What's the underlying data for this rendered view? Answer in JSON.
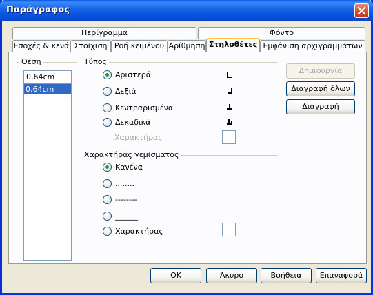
{
  "window": {
    "title": "Παράγραφος"
  },
  "tabs_row1": [
    {
      "label": "Περίγραμμα"
    },
    {
      "label": "Φόντο"
    }
  ],
  "tabs_row2": [
    {
      "label": "Εσοχές & κενά"
    },
    {
      "label": "Στοίχιση"
    },
    {
      "label": "Ροή κειμένου"
    },
    {
      "label": "Αρίθμηση"
    },
    {
      "label": "Στηλοθέτες"
    },
    {
      "label": "Εμφάνιση αρχιγραμμάτων"
    }
  ],
  "position": {
    "group_label": "Θέση",
    "input_value": "0,64cm",
    "list_items": [
      "0,64cm"
    ]
  },
  "type": {
    "group_label": "Τύπος",
    "options": [
      {
        "label": "Αριστερά",
        "checked": true,
        "icon": "tab-left-icon"
      },
      {
        "label": "Δεξιά",
        "checked": false,
        "icon": "tab-right-icon"
      },
      {
        "label": "Κεντραρισμένα",
        "checked": false,
        "icon": "tab-center-icon"
      },
      {
        "label": "Δεκαδικά",
        "checked": false,
        "icon": "tab-decimal-icon"
      }
    ],
    "character_label": "Χαρακτήρας"
  },
  "fill": {
    "group_label": "Χαρακτήρας γεμίσματος",
    "options": [
      {
        "label": "Κανένα",
        "checked": true
      },
      {
        "label": "........",
        "checked": false
      },
      {
        "label": "--------",
        "checked": false
      },
      {
        "label": "______",
        "checked": false
      },
      {
        "label": "Χαρακτήρας",
        "checked": false
      }
    ]
  },
  "side_buttons": {
    "new": "Δημιουργία",
    "delete_all": "Διαγραφή όλων",
    "delete": "Διαγραφή"
  },
  "footer_buttons": {
    "ok": "OK",
    "cancel": "Άκυρο",
    "help": "Βοήθεια",
    "reset": "Επαναφορά"
  },
  "colors": {
    "titlebar": "#0a5ae6",
    "dialog_bg": "#ece9d8",
    "selection": "#316ac5",
    "radio_dot": "#21a121"
  }
}
